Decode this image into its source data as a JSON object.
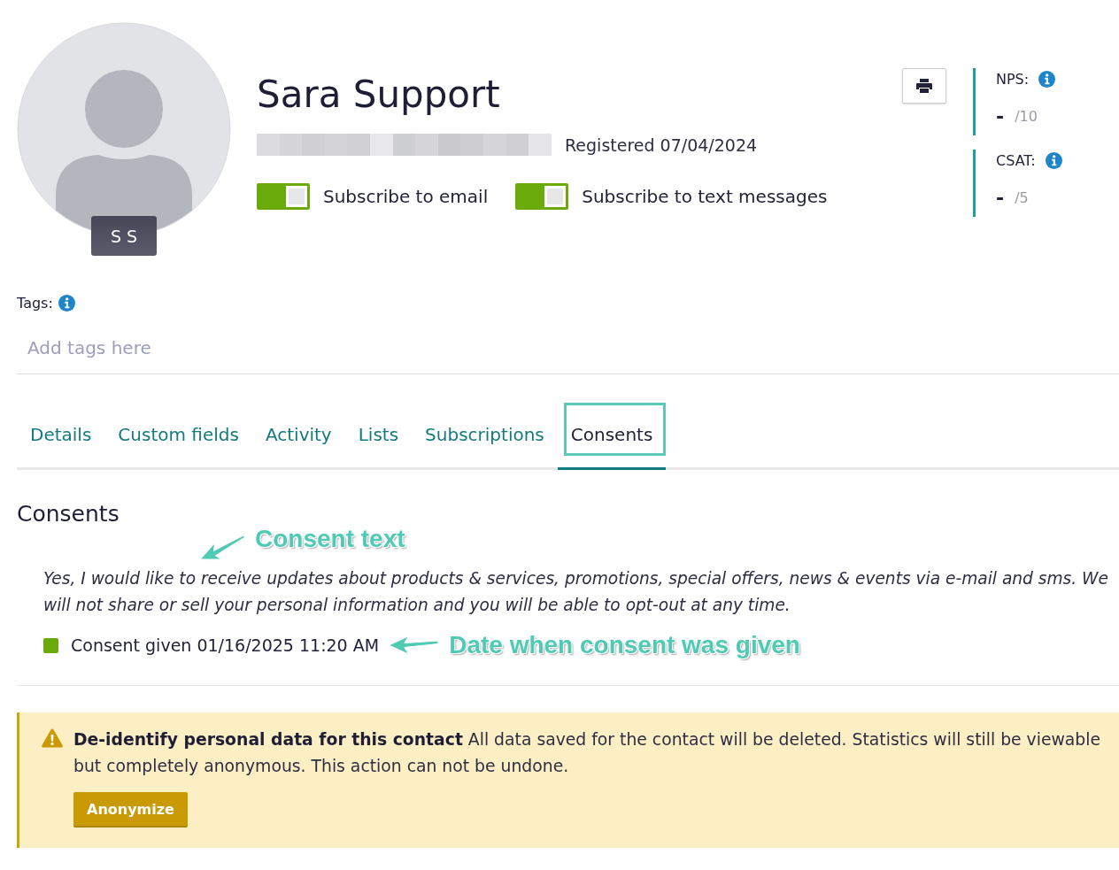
{
  "contact": {
    "name": "Sara Support",
    "initials": "S S",
    "registered": "Registered 07/04/2024"
  },
  "subscriptions": [
    {
      "label": "Subscribe to email",
      "on": true
    },
    {
      "label": "Subscribe to text messages",
      "on": true
    }
  ],
  "metrics": [
    {
      "label": "NPS:",
      "value": "-",
      "scale": "/10"
    },
    {
      "label": "CSAT:",
      "value": "-",
      "scale": "/5"
    }
  ],
  "tags": {
    "label": "Tags:",
    "placeholder": "Add tags here"
  },
  "tabs": [
    {
      "label": "Details",
      "selected": false,
      "focused": false
    },
    {
      "label": "Custom fields",
      "selected": false,
      "focused": false
    },
    {
      "label": "Activity",
      "selected": false,
      "focused": false
    },
    {
      "label": "Lists",
      "selected": false,
      "focused": false
    },
    {
      "label": "Subscriptions",
      "selected": false,
      "focused": false
    },
    {
      "label": "Consents",
      "selected": true,
      "focused": true
    }
  ],
  "consents": {
    "title": "Consents",
    "text_note": "Consent text",
    "text": "Yes, I would like to receive updates about products & services, promotions, special offers, news & events via e-mail and sms. We will not share or sell your personal information and you will be able to opt-out at any time.",
    "status": "Consent given 01/16/2025 11:20 AM",
    "given": true,
    "status_note": "Date when consent was given"
  },
  "warning": {
    "message": "**De-identify personal data for this contact** All data saved for the contact will be deleted. Statistics will still be viewable but completely anonymous. This action can not be undone.",
    "button": "Anonymize"
  }
}
